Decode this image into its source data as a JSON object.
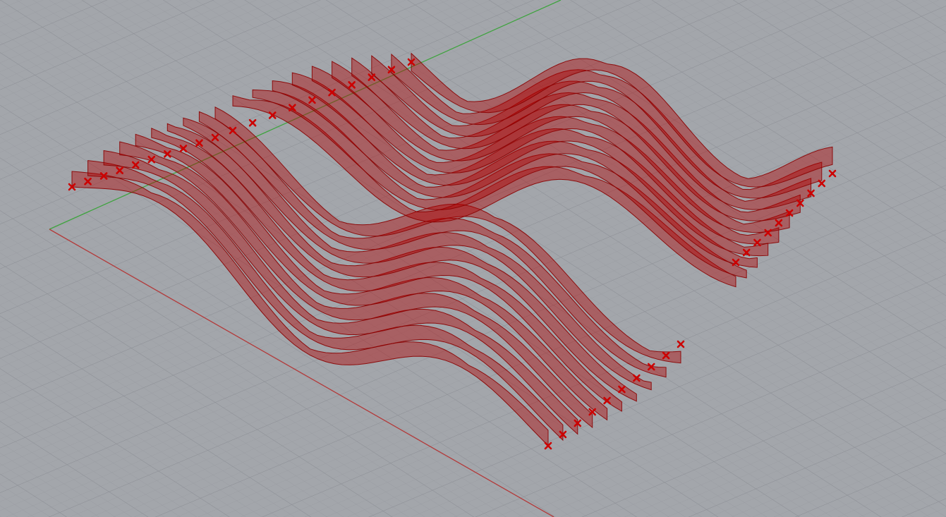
{
  "viewport": {
    "name": "perspective-3d-viewport",
    "background_color": "#a3a6ab",
    "grid_minor_color": "#9a9da2",
    "grid_major_color": "#8e9196",
    "axis_x_color": "#b33a3a",
    "axis_y_color": "#3fa33f"
  },
  "scene": {
    "object_type": "wavy-ribbon-surfaces",
    "ribbon_fill_color": "#b00000",
    "ribbon_edge_color": "#8a0000",
    "control_point_marker": "x-mark",
    "control_point_color": "#cc0000",
    "ribbon_groups": 2,
    "ribbons_per_group": 10
  }
}
